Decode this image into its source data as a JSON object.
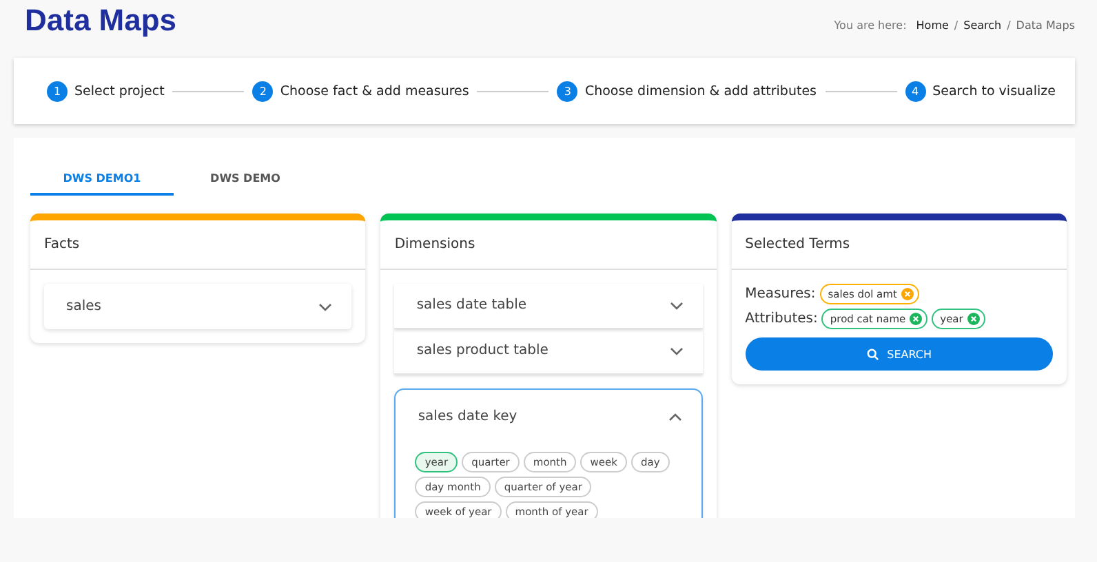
{
  "page_title": "Data Maps",
  "breadcrumb": {
    "prefix": "You are here:",
    "separator": "/",
    "items": [
      {
        "label": "Home",
        "kind": "link"
      },
      {
        "label": "Search",
        "kind": "link"
      },
      {
        "label": "Data Maps",
        "kind": "current"
      }
    ]
  },
  "stepper": [
    {
      "number": "1",
      "label": "Select project"
    },
    {
      "number": "2",
      "label": "Choose fact & add measures"
    },
    {
      "number": "3",
      "label": "Choose dimension & add attributes"
    },
    {
      "number": "4",
      "label": "Search to visualize"
    }
  ],
  "tabs": [
    {
      "label": "DWS DEMO1",
      "selected": true
    },
    {
      "label": "DWS DEMO",
      "selected": false
    }
  ],
  "facts": {
    "title": "Facts",
    "items": [
      {
        "label": "sales",
        "expanded": false
      }
    ]
  },
  "dimensions": {
    "title": "Dimensions",
    "items": [
      {
        "label": "sales date table",
        "expanded": false
      },
      {
        "label": "sales product table",
        "expanded": false
      },
      {
        "label": "sales date key",
        "expanded": true,
        "attributes": [
          {
            "label": "year",
            "selected": true
          },
          {
            "label": "quarter",
            "selected": false
          },
          {
            "label": "month",
            "selected": false
          },
          {
            "label": "week",
            "selected": false
          },
          {
            "label": "day",
            "selected": false
          },
          {
            "label": "day month",
            "selected": false
          },
          {
            "label": "quarter of year",
            "selected": false
          },
          {
            "label": "week of year",
            "selected": false
          },
          {
            "label": "month of year",
            "selected": false
          }
        ]
      }
    ]
  },
  "selected_terms": {
    "title": "Selected Terms",
    "groups": [
      {
        "label": "Measures:",
        "kind": "measure",
        "terms": [
          "sales dol amt"
        ]
      },
      {
        "label": "Attributes:",
        "kind": "attribute",
        "terms": [
          "prod cat name",
          "year"
        ]
      }
    ],
    "search_button": "SEARCH"
  }
}
